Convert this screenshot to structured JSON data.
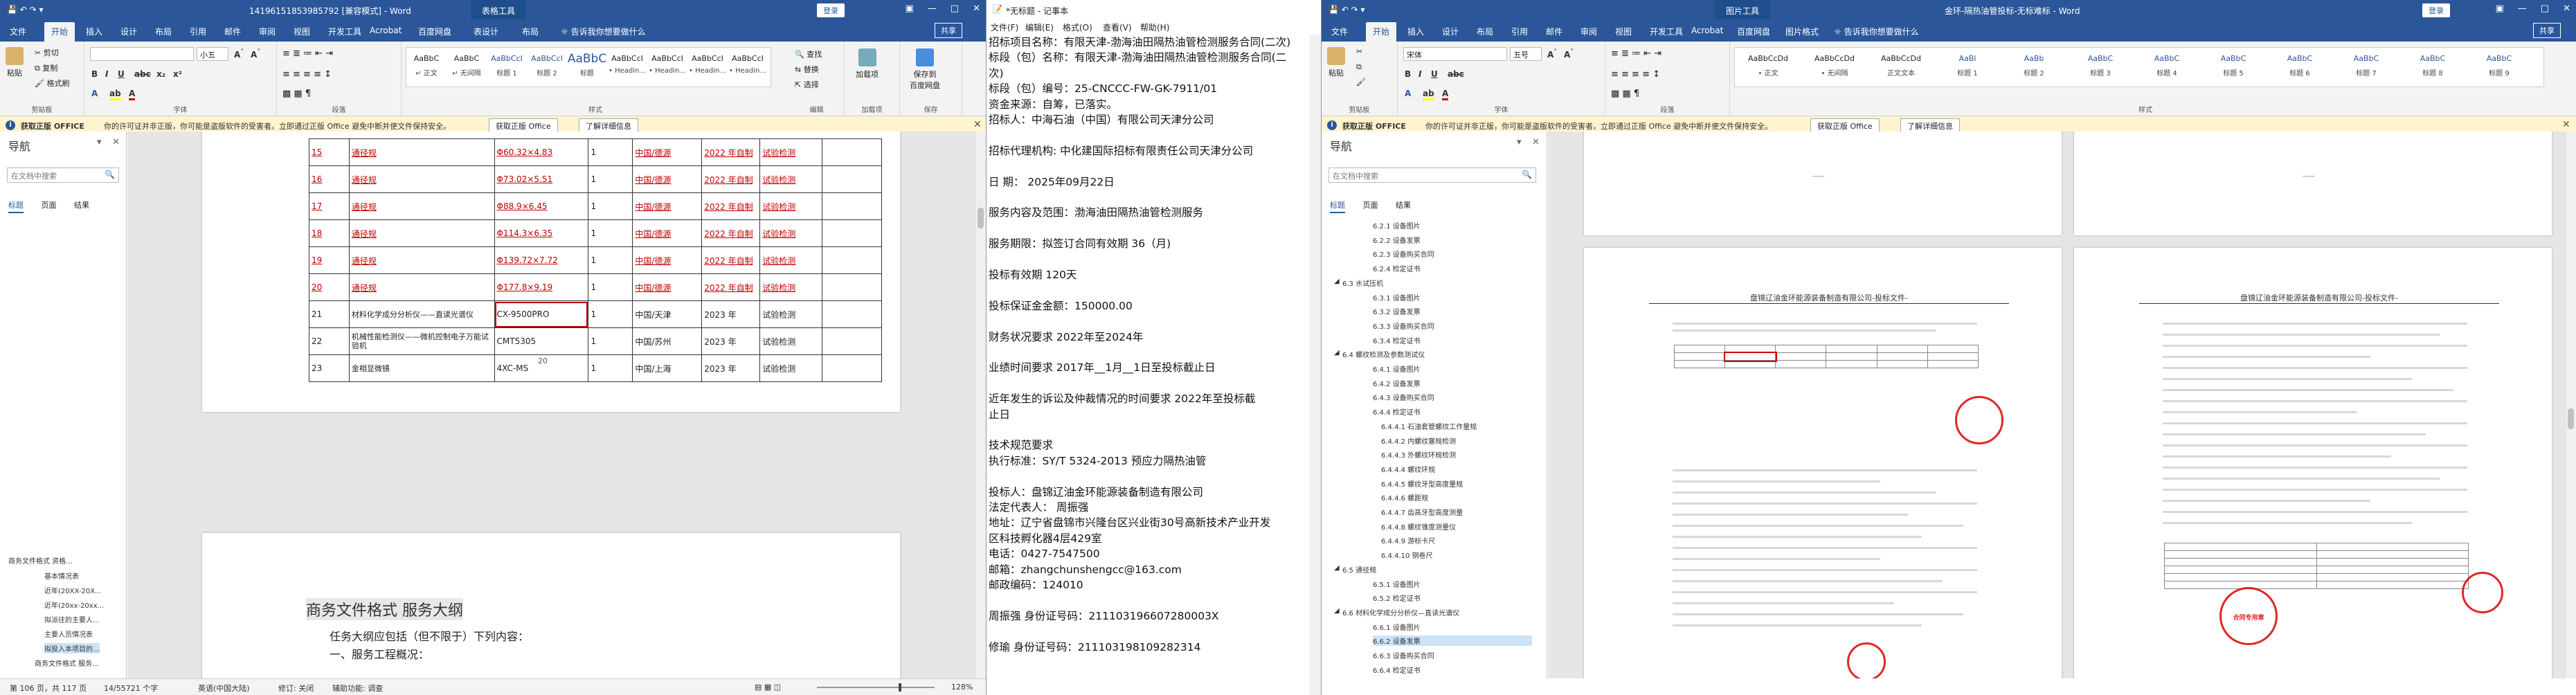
{
  "left": {
    "title": "14196151853985792 [兼容模式] - Word",
    "context_tab": "表格工具",
    "login": "登录",
    "tabs": [
      "文件",
      "开始",
      "插入",
      "设计",
      "布局",
      "引用",
      "邮件",
      "审阅",
      "视图",
      "开发工具",
      "Acrobat",
      "百度网盘",
      "表设计",
      "布局",
      "告诉我你想要做什么"
    ],
    "share": "共享",
    "ribbon": {
      "paste": "粘贴",
      "cut": "剪切",
      "copy": "复制",
      "painter": "格式刷",
      "clipboard": "剪贴板",
      "font_name": "",
      "font_size": "小五",
      "font_group": "字体",
      "para_group": "段落",
      "styles": [
        {
          "sample": "AaBbC",
          "name": "↵ 正文"
        },
        {
          "sample": "AaBbC",
          "name": "↵ 无间隔"
        },
        {
          "sample": "AaBbCcI",
          "name": "标题 1"
        },
        {
          "sample": "AaBbCcI",
          "name": "标题 2"
        },
        {
          "sample": "AaBbC",
          "name": "标题"
        },
        {
          "sample": "AaBbCcI",
          "name": "• Headin..."
        },
        {
          "sample": "AaBbCcI",
          "name": "• Headin..."
        },
        {
          "sample": "AaBbCcI",
          "name": "• Headin..."
        },
        {
          "sample": "AaBbCcI",
          "name": "• Headin..."
        }
      ],
      "style_group": "样式",
      "find": "查找",
      "replace": "替换",
      "select": "选择",
      "edit_group": "编辑",
      "addin": "加载项",
      "addin_group": "加载项",
      "baidu": "保存到\n百度网盘",
      "baidu_group": "保存"
    },
    "msgbar": {
      "label": "获取正版 OFFICE",
      "text": "你的许可证并非正版，你可能是盗版软件的受害者。立即通过正版 Office 避免中断并使文件保持安全。",
      "btn1": "获取正版 Office",
      "btn2": "了解详细信息"
    },
    "nav": {
      "title": "导航",
      "search_placeholder": "在文档中搜索",
      "tabs": [
        "标题",
        "页面",
        "结果"
      ],
      "headings": [
        "商务文件格式 资格...",
        "基本情况表",
        "近年(20XX-20X...",
        "近年(20xx-20xx...",
        "拟派往的主要人...",
        "主要人员情况表",
        "拟投入本项目的...",
        "商务文件格式 服务..."
      ]
    },
    "table": {
      "rows": [
        {
          "no": "15",
          "name": "通径规",
          "spec": "Φ60.32×4.83",
          "qty": "1",
          "origin": "中国/德源",
          "year": "2022 年自制",
          "use": "试验检测",
          "red": true
        },
        {
          "no": "16",
          "name": "通径规",
          "spec": "Φ73.02×5.51",
          "qty": "1",
          "origin": "中国/德源",
          "year": "2022 年自制",
          "use": "试验检测",
          "red": true
        },
        {
          "no": "17",
          "name": "通径规",
          "spec": "Φ88.9×6.45",
          "qty": "1",
          "origin": "中国/德源",
          "year": "2022 年自制",
          "use": "试验检测",
          "red": true
        },
        {
          "no": "18",
          "name": "通径规",
          "spec": "Φ114.3×6.35",
          "qty": "1",
          "origin": "中国/德源",
          "year": "2022 年自制",
          "use": "试验检测",
          "red": true
        },
        {
          "no": "19",
          "name": "通径规",
          "spec": "Φ139.72×7.72",
          "qty": "1",
          "origin": "中国/德源",
          "year": "2022 年自制",
          "use": "试验检测",
          "red": true
        },
        {
          "no": "20",
          "name": "通径规",
          "spec": "Φ177.8×9.19",
          "qty": "1",
          "origin": "中国/德源",
          "year": "2022 年自制",
          "use": "试验检测",
          "red": true
        },
        {
          "no": "21",
          "name": "材料化学成分分析仪——直读光谱仪",
          "spec": "CX-9500PRO",
          "qty": "1",
          "origin": "中国/天津",
          "year": "2023 年",
          "use": "试验检测",
          "red": false
        },
        {
          "no": "22",
          "name": "机械性能检测仪——微机控制电子万能试验机",
          "spec": "CMT5305",
          "qty": "1",
          "origin": "中国/苏州",
          "year": "2023 年",
          "use": "试验检测",
          "red": false
        },
        {
          "no": "23",
          "name": "金相显微镜",
          "spec": "4XC-MS",
          "qty": "1",
          "origin": "中国/上海",
          "year": "2023 年",
          "use": "试验检测",
          "red": false
        }
      ],
      "page_num": "20"
    },
    "page2": {
      "heading": "商务文件格式 服务大纲",
      "line1": "任务大纲应包括（但不限于）下列内容：",
      "line2": "一、服务工程概况："
    },
    "status": {
      "page": "第 106 页，共 117 页",
      "words": "14/55721 个字",
      "lang": "英语(中国大陆)",
      "revision": "修订: 关闭",
      "access": "辅助功能: 调查",
      "zoom": "128%"
    }
  },
  "notepad": {
    "title": "*无标题 - 记事本",
    "menu": [
      "文件(F)",
      "编辑(E)",
      "格式(O)",
      "查看(V)",
      "帮助(H)"
    ],
    "lines": [
      "招标项目名称：有限天津-渤海油田隔热油管检测服务合同(二次)",
      "标段（包）名称：有限天津-渤海油田隔热油管检测服务合同(二",
      "次)",
      "标段（包）编号：25-CNCCC-FW-GK-7911/01",
      "资金来源：自筹，已落实。",
      "招标人：中海石油（中国）有限公司天津分公司",
      "",
      "招标代理机构:        中化建国际招标有限责任公司天津分公司",
      "",
      "日    期：           2025年09月22日",
      "",
      "服务内容及范围：渤海油田隔热油管检测服务",
      "",
      "服务期限：拟签订合同有效期 36（月)",
      "",
      "投标有效期           120天",
      "",
      "投标保证金金额：150000.00",
      "",
      "财务状况要求          2022年至2024年",
      "",
      "业绩时间要求          2017年__1月__1日至投标截止日",
      "",
      "近年发生的诉讼及仲裁情况的时间要求          2022年至投标截",
      "止日",
      "",
      "技术规范要求",
      "执行标准：SY/T 5324-2013 预应力隔热油管",
      "",
      "投标人：盘锦辽油金环能源装备制造有限公司",
      "法定代表人：    周振强",
      "地址：辽宁省盘锦市兴隆台区兴业街30号高新技术产业开发",
      "区科技孵化器4层429室",
      "电话：0427-7547500",
      "邮箱：zhangchunshengcc@163.com",
      "邮政编码：124010",
      "",
      "周振强      身份证号码：211103196607280003X",
      "",
      "修瑜        身份证号码：211103198109282314"
    ]
  },
  "right": {
    "title": "金环-隔热油管投标-无标难标 - Word",
    "context_tab": "图片工具",
    "login": "登录",
    "tabs": [
      "文件",
      "开始",
      "插入",
      "设计",
      "布局",
      "引用",
      "邮件",
      "审阅",
      "视图",
      "开发工具",
      "Acrobat",
      "百度网盘",
      "图片格式",
      "告诉我你想要做什么"
    ],
    "share": "共享",
    "ribbon": {
      "paste": "粘贴",
      "clipboard": "剪贴板",
      "font_name": "宋体",
      "font_size": "五号",
      "font_group": "字体",
      "para_group": "段落",
      "styles": [
        {
          "sample": "AaBbCcDd",
          "name": "• 正文"
        },
        {
          "sample": "AaBbCcDd",
          "name": "• 无间隔"
        },
        {
          "sample": "AaBbCcDd",
          "name": "正文文本"
        },
        {
          "sample": "AaBl",
          "name": "标题 1"
        },
        {
          "sample": "AaBb",
          "name": "标题 2"
        },
        {
          "sample": "AaBbC",
          "name": "标题 3"
        },
        {
          "sample": "AaBbC",
          "name": "标题 4"
        },
        {
          "sample": "AaBbC",
          "name": "标题 5"
        },
        {
          "sample": "AaBbC",
          "name": "标题 6"
        },
        {
          "sample": "AaBbC",
          "name": "标题 7"
        },
        {
          "sample": "AaBbC",
          "name": "标题 8"
        },
        {
          "sample": "AaBbC",
          "name": "标题 9"
        }
      ],
      "style_group": "样式"
    },
    "msgbar": {
      "label": "获取正版 OFFICE",
      "text": "你的许可证并非正版，你可能是盗版软件的受害者。立即通过正版 Office 避免中断并使文件保持安全。",
      "btn1": "获取正版 Office",
      "btn2": "了解详细信息"
    },
    "nav": {
      "title": "导航",
      "search_placeholder": "在文档中搜索",
      "tabs": [
        "标题",
        "页面",
        "结果"
      ],
      "headings": [
        {
          "t": "6.2.1 设备图片",
          "lv": 2
        },
        {
          "t": "6.2.2 设备发票",
          "lv": 2
        },
        {
          "t": "6.2.3 设备购买合同",
          "lv": 2
        },
        {
          "t": "6.2.4 检定证书",
          "lv": 2
        },
        {
          "t": "6.3 水试压机",
          "lv": 1
        },
        {
          "t": "6.3.1 设备图片",
          "lv": 2
        },
        {
          "t": "6.3.2 设备发票",
          "lv": 2
        },
        {
          "t": "6.3.3 设备购买合同",
          "lv": 2
        },
        {
          "t": "6.3.4 检定证书",
          "lv": 2
        },
        {
          "t": "6.4 螺纹检测及参数测试仪",
          "lv": 1
        },
        {
          "t": "6.4.1 设备图片",
          "lv": 2
        },
        {
          "t": "6.4.2 设备发票",
          "lv": 2
        },
        {
          "t": "6.4.3 设备购买合同",
          "lv": 2
        },
        {
          "t": "6.4.4 检定证书",
          "lv": 2
        },
        {
          "t": "6.4.4.1 石油套管螺纹工作量规",
          "lv": 3
        },
        {
          "t": "6.4.4.2 内螺纹塞规检测",
          "lv": 3
        },
        {
          "t": "6.4.4.3 外螺纹环规检测",
          "lv": 3
        },
        {
          "t": "6.4.4.4 螺纹环规",
          "lv": 3
        },
        {
          "t": "6.4.4.5 螺纹牙型高度量规",
          "lv": 3
        },
        {
          "t": "6.4.4.6 螺距规",
          "lv": 3
        },
        {
          "t": "6.4.4.7 齿高牙型高度测量",
          "lv": 3
        },
        {
          "t": "6.4.4.8 螺纹锥度测量仪",
          "lv": 3
        },
        {
          "t": "6.4.4.9 游标卡尺",
          "lv": 3
        },
        {
          "t": "6.4.4.10 钢卷尺",
          "lv": 3
        },
        {
          "t": "6.5 通径规",
          "lv": 1
        },
        {
          "t": "6.5.1 设备图片",
          "lv": 2
        },
        {
          "t": "6.5.2 检定证书",
          "lv": 2
        },
        {
          "t": "6.6 材料化学成分分析仪—直读光谱仪",
          "lv": 1
        },
        {
          "t": "6.6.1 设备图片",
          "lv": 2
        },
        {
          "t": "6.6.2 设备发票",
          "lv": 2,
          "sel": true
        },
        {
          "t": "6.6.3 设备购买合同",
          "lv": 2
        },
        {
          "t": "6.6.4 检定证书",
          "lv": 2
        }
      ]
    },
    "doc": {
      "header_left": "盘锦辽油金环能源装备制造有限公司-投标文件-",
      "header_right": "盘锦辽油金环能源装备制造有限公司-投标文件-",
      "stamp_text": "合同专用章"
    }
  }
}
